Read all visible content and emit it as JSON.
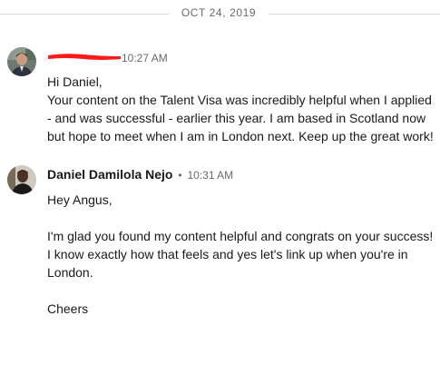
{
  "date_divider": "OCT 24, 2019",
  "colors": {
    "redaction": "#ff1a1a",
    "muted_text": "#666666",
    "divider": "#d9d9d9"
  },
  "messages": [
    {
      "sender": "",
      "sender_redacted": true,
      "time": "10:27 AM",
      "lines": [
        "Hi Daniel,",
        "Your content on the Talent Visa was incredibly helpful when I applied",
        "- and was successful - earlier this year. I am based in Scotland now",
        "but hope to meet when I am in London next. Keep up the great work!"
      ]
    },
    {
      "sender": "Daniel Damilola Nejo",
      "separator": "•",
      "time": "10:31 AM",
      "lines": [
        "Hey Angus,",
        "",
        "I'm glad you found my content helpful and congrats on your success!",
        "I know exactly how that feels and yes let's link up when you're in",
        "London.",
        "",
        "Cheers"
      ]
    }
  ]
}
